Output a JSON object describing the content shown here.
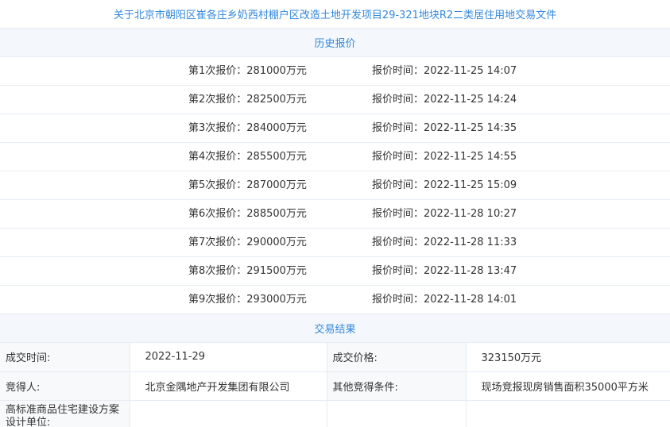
{
  "title": "关于北京市朝阳区崔各庄乡奶西村棚户区改造土地开发项目29-321地块R2二类居住用地交易文件",
  "history": {
    "header": "历史报价",
    "bids": [
      {
        "amount": "第1次报价：281000万元",
        "time": "报价时间：2022-11-25 14:07"
      },
      {
        "amount": "第2次报价：282500万元",
        "time": "报价时间：2022-11-25 14:24"
      },
      {
        "amount": "第3次报价：284000万元",
        "time": "报价时间：2022-11-25 14:35"
      },
      {
        "amount": "第4次报价：285500万元",
        "time": "报价时间：2022-11-25 14:55"
      },
      {
        "amount": "第5次报价：287000万元",
        "time": "报价时间：2022-11-25 15:09"
      },
      {
        "amount": "第6次报价：288500万元",
        "time": "报价时间：2022-11-28 10:27"
      },
      {
        "amount": "第7次报价：290000万元",
        "time": "报价时间：2022-11-28 11:33"
      },
      {
        "amount": "第8次报价：291500万元",
        "time": "报价时间：2022-11-28 13:47"
      },
      {
        "amount": "第9次报价：293000万元",
        "time": "报价时间：2022-11-28 14:01"
      }
    ]
  },
  "result": {
    "header": "交易结果",
    "deal_time_label": "成交时间:",
    "deal_time_value": "2022-11-29",
    "deal_price_label": "成交价格:",
    "deal_price_value": "323150万元",
    "winner_label": "竞得人:",
    "winner_value": "北京金隅地产开发集团有限公司",
    "other_conditions_label": "其他竞得条件:",
    "other_conditions_value": "现场竞报现房销售面积35000平方米",
    "design_unit_label": "高标准商品住宅建设方案设计单位:",
    "design_unit_value": ""
  }
}
